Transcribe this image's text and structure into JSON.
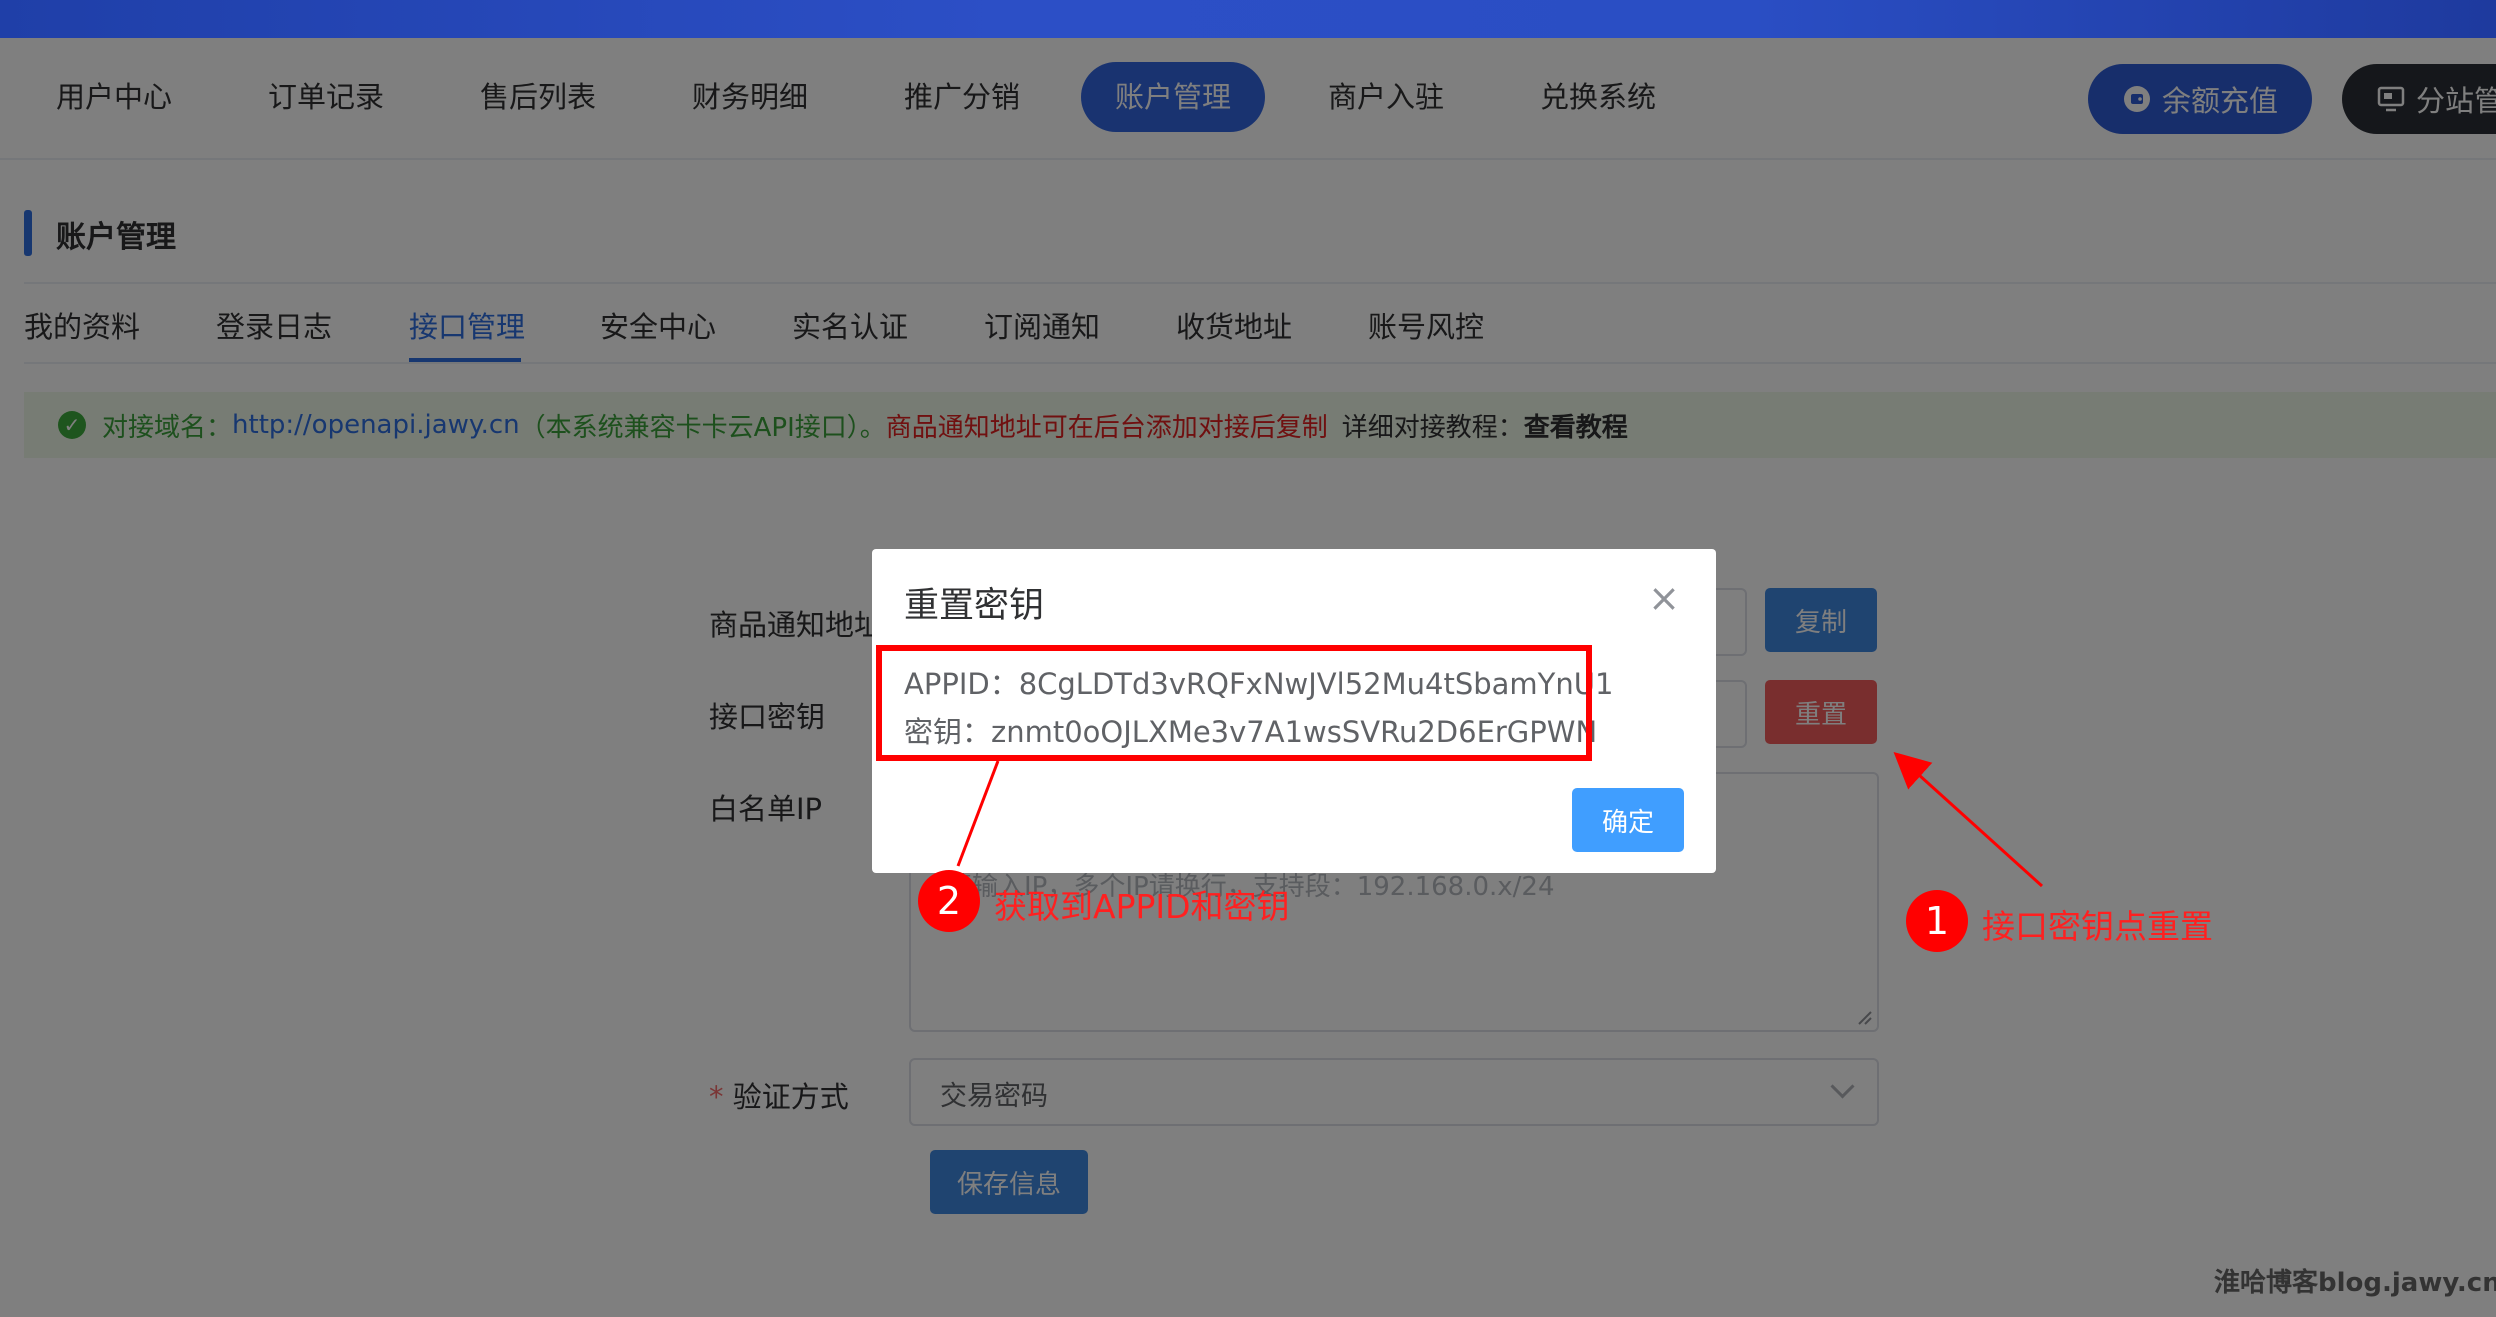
{
  "nav": {
    "items": [
      "用户中心",
      "订单记录",
      "售后列表",
      "财务明细",
      "推广分销",
      "账户管理",
      "商户入驻",
      "兑换系统"
    ],
    "recharge_label": "余额充值",
    "substation_label": "分站管"
  },
  "section": {
    "title": "账户管理"
  },
  "subtabs": [
    "我的资料",
    "登录日志",
    "接口管理",
    "安全中心",
    "实名认证",
    "订阅通知",
    "收货地址",
    "账号风控"
  ],
  "alert": {
    "label": "对接域名：",
    "url": "http://openapi.jawy.cn",
    "compat": "（本系统兼容卡卡云API接口）。",
    "red": "商品通知地址可在后台添加对接后复制",
    "tutorial_label": "详细对接教程：",
    "tutorial_link": "查看教程"
  },
  "form": {
    "notify_label": "商品通知地址",
    "copy_label": "复制",
    "key_label": "接口密钥",
    "reset_label": "重置",
    "whitelist_label": "白名单IP",
    "whitelist_placeholder": "请输入IP，多个IP请换行，支持段：192.168.0.x/24",
    "verify_label": "验证方式",
    "verify_required": "*",
    "verify_value": "交易密码",
    "save_label": "保存信息"
  },
  "dialog": {
    "title": "重置密钥",
    "appid_line": "APPID：8CgLDTd3vRQFxNwJVl52Mu4tSbamYnU1",
    "secret_line": "密钥：znmt0oOJLXMe3v7A1wsSVRu2D6ErGPWN",
    "ok_label": "确定"
  },
  "annotations": {
    "step1_num": "1",
    "step1_text": "接口密钥点重置",
    "step2_num": "2",
    "step2_text": "获取到APPID和密钥"
  },
  "watermark": "淮哈博客blog.jawy.cn"
}
